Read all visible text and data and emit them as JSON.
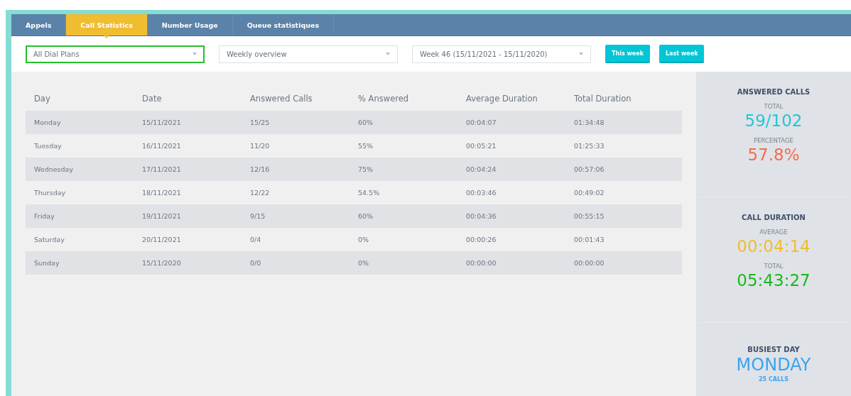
{
  "tabs": [
    {
      "label": "Appels",
      "selected": false
    },
    {
      "label": "Call Statistics",
      "selected": true
    },
    {
      "label": "Number Usage",
      "selected": false
    },
    {
      "label": "Queue statistiques",
      "selected": false
    }
  ],
  "filters": [
    {
      "value": "All Dial Plans",
      "focused": true
    },
    {
      "value": "Weekly overview",
      "focused": false
    },
    {
      "value": "Week 46 (15/11/2021 - 15/11/2020)",
      "focused": false
    }
  ],
  "buttons": [
    "This week",
    "Last week"
  ],
  "table": {
    "columns": [
      "Day",
      "Date",
      "Answered Calls",
      "% Answered",
      "Average Duration",
      "Total Duration"
    ],
    "rows": [
      [
        "Monday",
        "15/11/2021",
        "15/25",
        "60%",
        "00:04:07",
        "01:34:48"
      ],
      [
        "Tuesday",
        "16/11/2021",
        "11/20",
        "55%",
        "00:05:21",
        "01:25:33"
      ],
      [
        "Wednesday",
        "17/11/2021",
        "12/16",
        "75%",
        "00:04:24",
        "00:57:06"
      ],
      [
        "Thursday",
        "18/11/2021",
        "12/22",
        "54.5%",
        "00:03:46",
        "00:49:02"
      ],
      [
        "Friday",
        "19/11/2021",
        "9/15",
        "60%",
        "00:04:36",
        "00:55:15"
      ],
      [
        "Saturday",
        "20/11/2021",
        "0/4",
        "0%",
        "00:00:26",
        "00:01:43"
      ],
      [
        "Sunday",
        "15/11/2020",
        "0/0",
        "0%",
        "00:00:00",
        "00:00:00"
      ]
    ]
  },
  "summary": [
    {
      "title": "ANSWERED CALLS",
      "kind": "pair",
      "stats": [
        {
          "label": "TOTAL",
          "value": "59/102",
          "color": "#1ec8d8"
        },
        {
          "label": "PERCENTAGE",
          "value": "57.8%",
          "color": "#f86a4a"
        }
      ]
    },
    {
      "title": "CALL DURATION",
      "kind": "pair",
      "stats": [
        {
          "label": "AVERAGE",
          "value": "00:04:14",
          "color": "#f0bd30"
        },
        {
          "label": "TOTAL",
          "value": "05:43:27",
          "color": "#19b81e"
        }
      ]
    },
    {
      "title": "BUSIEST DAY",
      "kind": "highlight",
      "value": "MONDAY",
      "note": "25 CALLS",
      "color": "#3aa4ef"
    }
  ]
}
